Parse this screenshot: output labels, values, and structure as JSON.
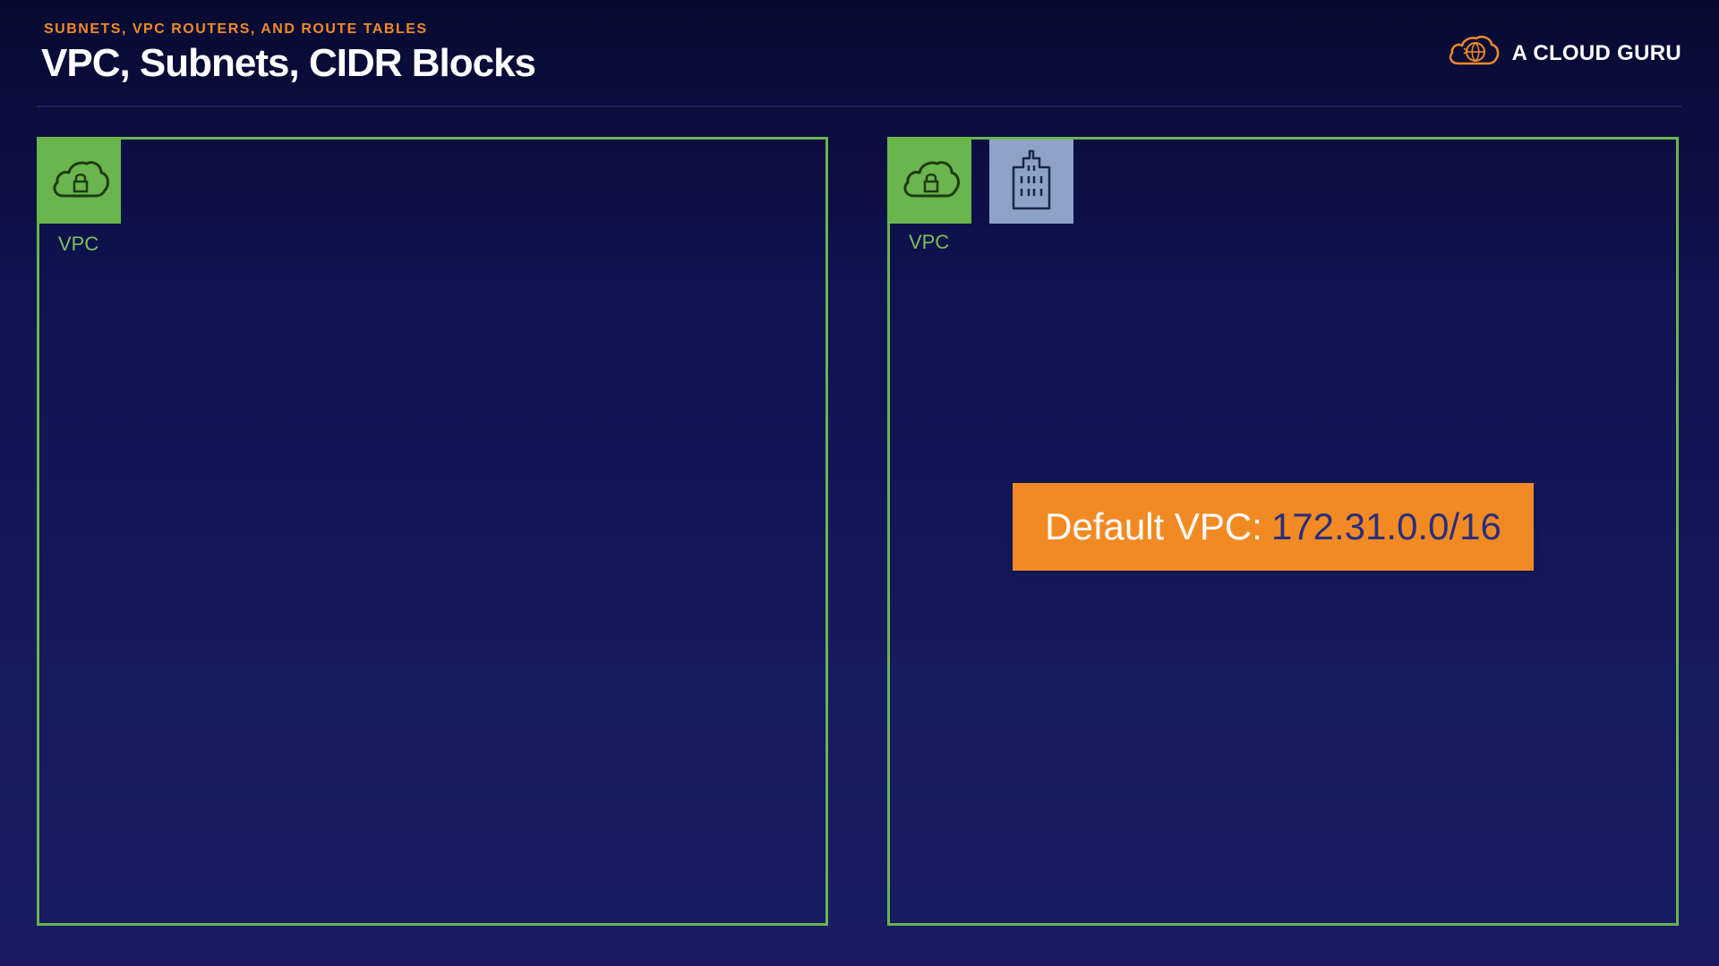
{
  "header": {
    "eyebrow": "SUBNETS, VPC ROUTERS, AND ROUTE TABLES",
    "title": "VPC, Subnets, CIDR Blocks"
  },
  "brand": {
    "name": "A CLOUD GURU",
    "icon": "cloud-logo-icon"
  },
  "diagram": {
    "left_vpc": {
      "label": "VPC",
      "icon": "cloud-lock-icon"
    },
    "right_vpc": {
      "label": "VPC",
      "icon": "cloud-lock-icon",
      "extra_icon": "building-icon"
    },
    "cidr_banner": {
      "label": "Default VPC:",
      "value": "172.31.0.0/16"
    }
  },
  "colors": {
    "accent_orange": "#f28a24",
    "vpc_green": "#6ab54d",
    "building_blue": "#8ea2c8",
    "background": "#161a5e"
  }
}
